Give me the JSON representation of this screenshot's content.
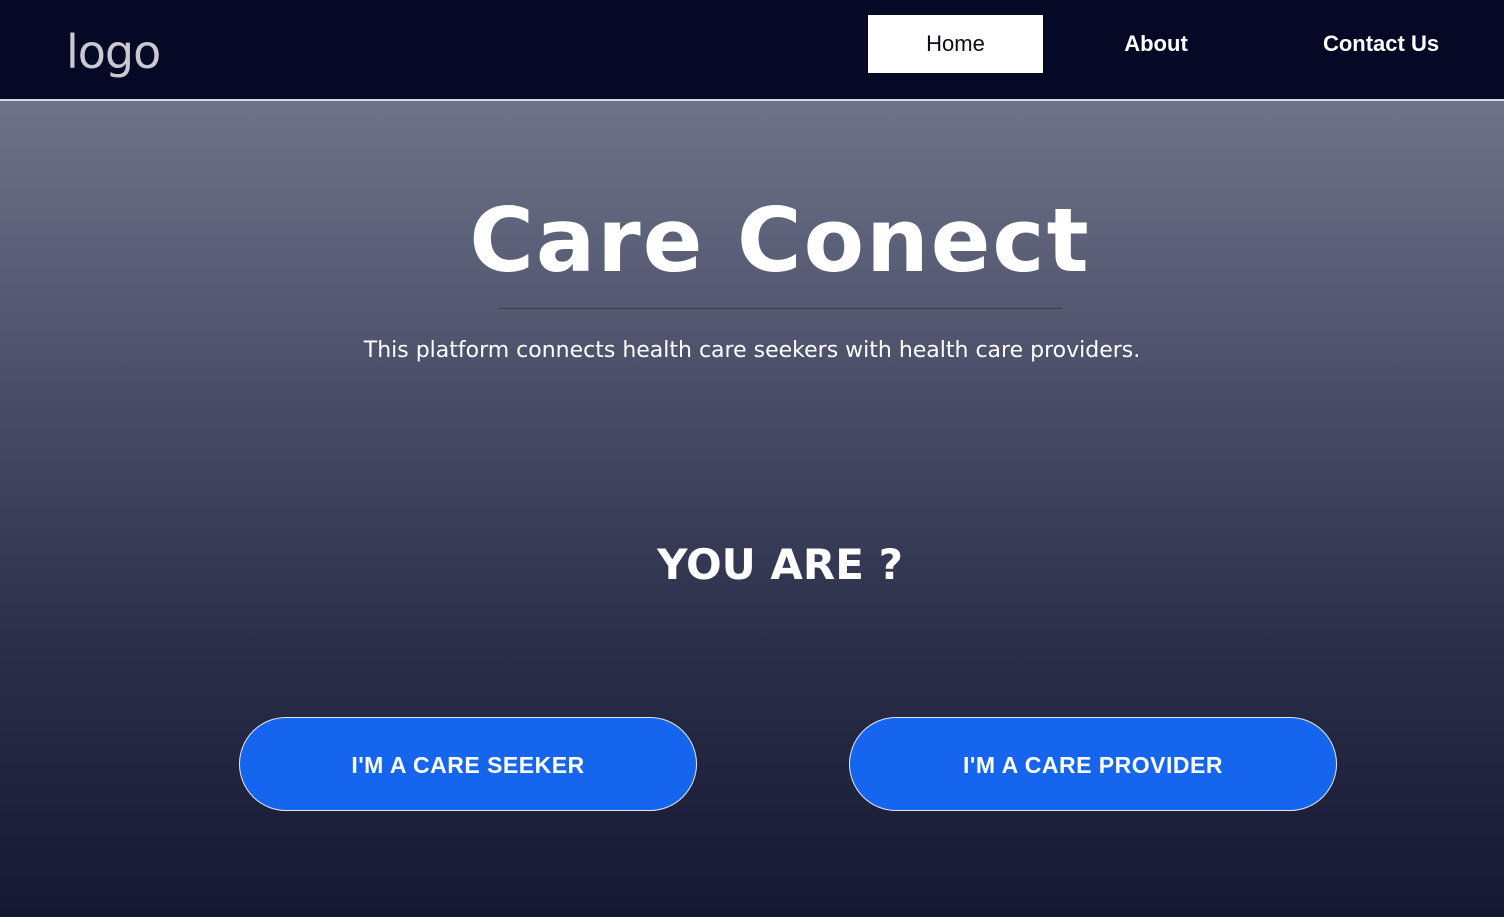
{
  "header": {
    "logo_text": "logo",
    "nav": {
      "home": "Home",
      "about": "About",
      "contact": "Contact Us"
    }
  },
  "hero": {
    "title": "Care Conect",
    "subtitle": "This platform connects health care seekers with health care providers.",
    "question": "YOU ARE ?",
    "buttons": {
      "seeker": "I'M A CARE SEEKER",
      "provider": "I'M A CARE PROVIDER"
    }
  },
  "colors": {
    "navbar_bg": "#050925",
    "button_blue": "#1565ee",
    "active_nav_bg": "#ffffff"
  }
}
